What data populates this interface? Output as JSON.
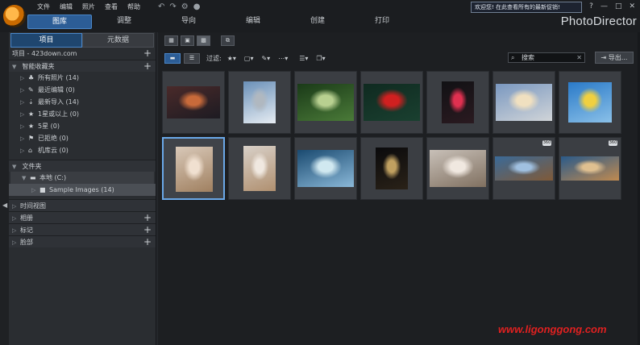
{
  "app": {
    "brand": "PhotoDirector",
    "menu": [
      "文件",
      "编辑",
      "照片",
      "查看",
      "帮助"
    ],
    "toolbar_icons": [
      "↶",
      "↷",
      "⚙",
      "●"
    ],
    "notice": "欢迎您! 在此查看所有的最新促销!",
    "window_controls": [
      "?",
      "—",
      "□",
      "✕"
    ],
    "mode_tabs": [
      "图库",
      "调整",
      "导向",
      "编辑",
      "创建",
      "打印"
    ]
  },
  "left": {
    "tabs": [
      "项目",
      "元数据"
    ],
    "project_label": "项目 - 423down.com",
    "smart_collections": {
      "title": "智能收藏夹",
      "items": [
        {
          "icon": "♣",
          "label": "所有照片 (14)"
        },
        {
          "icon": "✎",
          "label": "最近编辑 (0)"
        },
        {
          "icon": "⇣",
          "label": "最新导入 (14)"
        },
        {
          "icon": "★",
          "label": "1星或以上 (0)"
        },
        {
          "icon": "★",
          "label": "5星 (0)"
        },
        {
          "icon": "⚑",
          "label": "已拒绝 (0)"
        },
        {
          "icon": "⌂",
          "label": "机库云 (0)"
        }
      ]
    },
    "folders": {
      "title": "文件夹",
      "drive": "本地 (C:)",
      "folder": "Sample Images (14)"
    },
    "sections": [
      "时间视图",
      "相册",
      "标记",
      "脸部"
    ]
  },
  "main": {
    "filter_label": "过滤:",
    "filter_icons": [
      "★▾",
      "▢▾",
      "✎▾",
      "⋯▾"
    ],
    "sort_icon": "☰▾",
    "stack_icon": "❐▾",
    "search_placeholder": "搜索",
    "export_label": "导出..."
  },
  "thumbs": [
    {
      "colors": [
        "#4a2a2a",
        "#1d1b22"
      ],
      "accent": "#c86a3a",
      "w": 66,
      "h": 40
    },
    {
      "colors": [
        "#6a90b8",
        "#e6ecf2"
      ],
      "accent": "#b0b8c0",
      "w": 40,
      "h": 52
    },
    {
      "colors": [
        "#1a3a18",
        "#4a7a38"
      ],
      "accent": "#b8d090",
      "w": 70,
      "h": 46
    },
    {
      "colors": [
        "#0f2a20",
        "#1a4030"
      ],
      "accent": "#d02020",
      "w": 70,
      "h": 46
    },
    {
      "colors": [
        "#111114",
        "#2a1a20"
      ],
      "accent": "#e03050",
      "w": 40,
      "h": 52
    },
    {
      "colors": [
        "#7a98c0",
        "#d0d4d8"
      ],
      "accent": "#f0e0c0",
      "w": 70,
      "h": 46
    },
    {
      "colors": [
        "#2a7ac8",
        "#8ac0e8"
      ],
      "accent": "#f0d040",
      "w": 54,
      "h": 50
    },
    {
      "colors": [
        "#d8c8b8",
        "#a08060"
      ],
      "accent": "#f0e0d0",
      "w": 46,
      "h": 56
    },
    {
      "colors": [
        "#d8d0c8",
        "#b09070"
      ],
      "accent": "#f0e8e0",
      "w": 40,
      "h": 56
    },
    {
      "colors": [
        "#1a4a70",
        "#8ab8d8"
      ],
      "accent": "#d0e8f0",
      "w": 70,
      "h": 46
    },
    {
      "colors": [
        "#0a0a0c",
        "#2a2218"
      ],
      "accent": "#c0a060",
      "w": 40,
      "h": 52
    },
    {
      "colors": [
        "#c8c0b8",
        "#807060"
      ],
      "accent": "#f0e8e0",
      "w": 70,
      "h": 46
    },
    {
      "colors": [
        "#3a6a98",
        "#805a38"
      ],
      "accent": "#a0c0e0",
      "w": 72,
      "h": 30,
      "badge": "360"
    },
    {
      "colors": [
        "#2a5a8a",
        "#c08a50"
      ],
      "accent": "#e0c090",
      "w": 72,
      "h": 30,
      "badge": "360"
    }
  ],
  "watermark": "www.ligonggong.com"
}
